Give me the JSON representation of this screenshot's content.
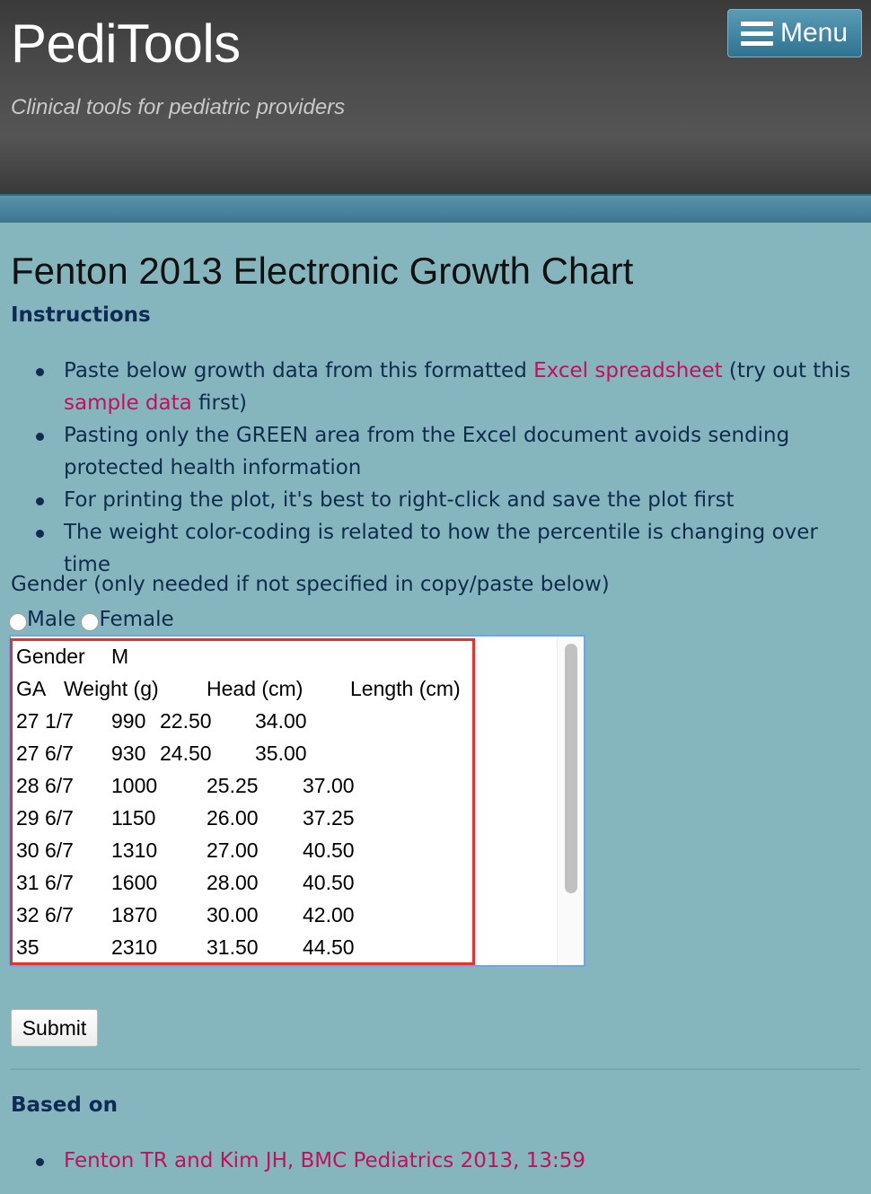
{
  "header": {
    "site_title": "PediTools",
    "tagline": "Clinical tools for pediatric providers",
    "menu_label": "Menu",
    "menu_icon": "hamburger-icon"
  },
  "main": {
    "page_title": "Fenton 2013 Electronic Growth Chart",
    "instructions_heading": "Instructions",
    "instructions": [
      {
        "pre": "Paste below growth data from this formatted ",
        "link1": "Excel spreadsheet",
        "mid": " (try out this ",
        "link2": "sample data",
        "post": " first)"
      },
      {
        "text": "Pasting only the GREEN area from the Excel document avoids sending protected health information"
      },
      {
        "text": "For printing the plot, it's best to right-click and save the plot first"
      },
      {
        "text": "The weight color-coding is related to how the percentile is changing over time"
      }
    ],
    "gender_label": "Gender (only needed if not specified in copy/paste below)",
    "gender_options": [
      "Male",
      "Female"
    ],
    "textarea": {
      "lines": [
        [
          "Gender",
          "M"
        ],
        [
          "GA",
          "Weight (g)",
          "Head (cm)",
          "Length (cm)"
        ],
        [
          "27 1/7",
          "990",
          "22.50",
          "34.00"
        ],
        [
          "27 6/7",
          "930",
          "24.50",
          "35.00"
        ],
        [
          "28 6/7",
          "1000",
          "25.25",
          "37.00"
        ],
        [
          "29 6/7",
          "1150",
          "26.00",
          "37.25"
        ],
        [
          "30 6/7",
          "1310",
          "27.00",
          "40.50"
        ],
        [
          "31 6/7",
          "1600",
          "28.00",
          "40.50"
        ],
        [
          "32 6/7",
          "1870",
          "30.00",
          "42.00"
        ],
        [
          "35",
          "2310",
          "31.50",
          "44.50"
        ]
      ]
    },
    "submit_label": "Submit",
    "based_on_heading": "Based on",
    "references": [
      "Fenton TR and Kim JH, BMC Pediatrics 2013, 13:59"
    ]
  },
  "colors": {
    "background": "#85b6bd",
    "link": "#c2105e",
    "heading": "#0d2b55",
    "highlight": "#e8302c"
  }
}
